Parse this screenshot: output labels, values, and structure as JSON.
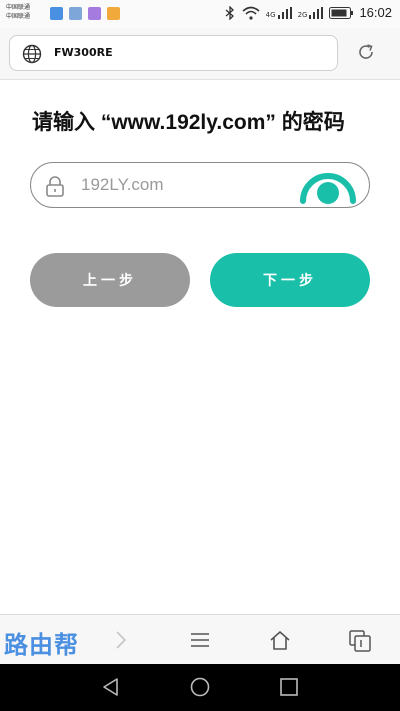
{
  "status_bar": {
    "carrier_line1": "中国联通",
    "carrier_line2": "中国联通",
    "signal_1": "4G",
    "signal_2": "2G",
    "time": "16:02"
  },
  "address_bar": {
    "url": "FW300RE",
    "icon": "globe-icon",
    "reload_icon": "reload-icon"
  },
  "main": {
    "heading": "请输入 “www.192ly.com” 的密码",
    "password_placeholder": "192LY.com",
    "password_value": "",
    "prev_button": "上一步",
    "next_button": "下一步"
  },
  "toolbar": {
    "watermark": "路由帮"
  },
  "colors": {
    "accent": "#1abfaa",
    "prev_button": "#9b9b9b"
  }
}
